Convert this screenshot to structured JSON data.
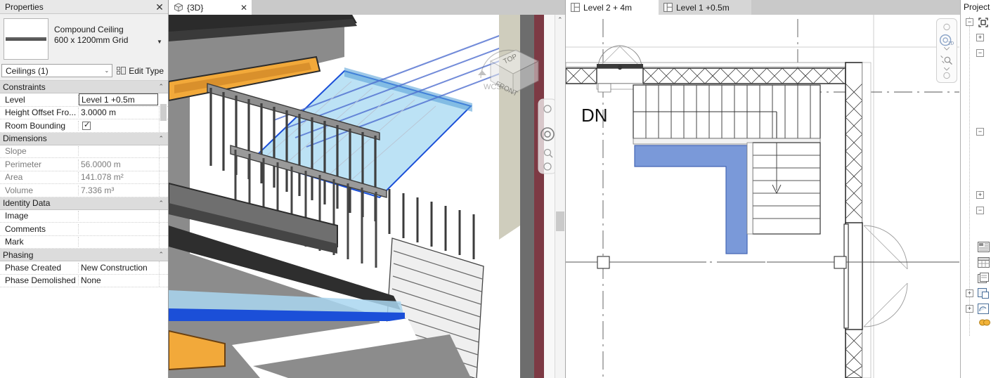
{
  "properties_panel": {
    "title": "Properties",
    "close_label": "✕",
    "family_type": {
      "family": "Compound Ceiling",
      "type": "600 x 1200mm Grid",
      "dropdown_arrow": "▼"
    },
    "selector": {
      "value": "Ceilings (1)",
      "arrow": "⌄"
    },
    "edit_type_button": "Edit Type",
    "groups": [
      {
        "name": "Constraints",
        "collapse": "⌃",
        "rows": [
          {
            "key": "Level",
            "value": "Level 1 +0.5m",
            "state": "active"
          },
          {
            "key": "Height Offset Fro...",
            "value": "3.0000 m",
            "state": "normal"
          },
          {
            "key": "Room Bounding",
            "value": "",
            "state": "checkbox"
          }
        ]
      },
      {
        "name": "Dimensions",
        "collapse": "⌃",
        "rows": [
          {
            "key": "Slope",
            "value": "",
            "state": "dim"
          },
          {
            "key": "Perimeter",
            "value": "56.0000 m",
            "state": "dim"
          },
          {
            "key": "Area",
            "value": "141.078 m²",
            "state": "dim"
          },
          {
            "key": "Volume",
            "value": "7.336 m³",
            "state": "dim"
          }
        ]
      },
      {
        "name": "Identity Data",
        "collapse": "⌃",
        "rows": [
          {
            "key": "Image",
            "value": "",
            "state": "normal"
          },
          {
            "key": "Comments",
            "value": "",
            "state": "normal"
          },
          {
            "key": "Mark",
            "value": "",
            "state": "normal"
          }
        ]
      },
      {
        "name": "Phasing",
        "collapse": "⌃",
        "rows": [
          {
            "key": "Phase Created",
            "value": "New Construction",
            "state": "normal"
          },
          {
            "key": "Phase Demolished",
            "value": "None",
            "state": "normal"
          }
        ]
      }
    ]
  },
  "view_tabs": {
    "view3d": {
      "label": "{3D}",
      "icon": "cube-3d-icon",
      "close_label": "✕"
    },
    "plan_tabs": [
      {
        "label": "Level 2 + 4m",
        "icon": "floor-plan-icon",
        "active": true
      },
      {
        "label": "Level 1 +0.5m",
        "icon": "floor-plan-icon",
        "active": false
      }
    ]
  },
  "view3d": {
    "viewcube": {
      "top_label": "TOP",
      "front_label": "FRONT",
      "wcs_label": "WCS"
    },
    "scroll_up_arrow": "⌃",
    "colors": {
      "selection_blue": "#1b4fd8",
      "ceiling_fill": "#9dd3f0",
      "window_frame": "#f0a93c",
      "floor_gray": "#8c8c8c"
    }
  },
  "plan_view": {
    "stair_label": "DN",
    "nav_wheel_label": "2D",
    "scroll_up_arrow": "⌃",
    "colors": {
      "landing_blue": "#7a99d9"
    }
  },
  "project_browser": {
    "title": "Project",
    "expand_glyph": "+",
    "collapse_glyph": "−"
  }
}
